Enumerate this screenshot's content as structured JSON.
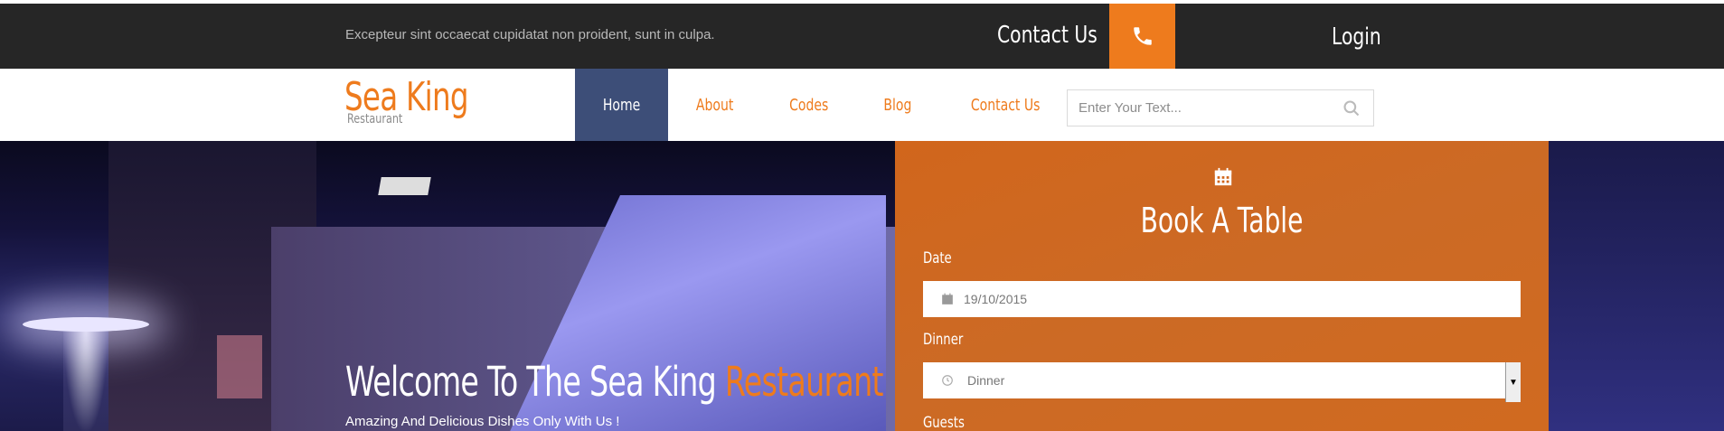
{
  "topbar": {
    "tagline": "Excepteur sint occaecat cupidatat non proident, sunt in culpa.",
    "contact_label": "Contact Us",
    "login_label": "Login",
    "phone_icon": "phone-icon",
    "background": "#262626",
    "accent": "#ee7b1d"
  },
  "logo": {
    "title": "Sea King",
    "subtitle": "Restaurant"
  },
  "nav": {
    "items": [
      {
        "label": "Home",
        "active": true
      },
      {
        "label": "About"
      },
      {
        "label": "Codes"
      },
      {
        "label": "Blog"
      },
      {
        "label": "Contact Us"
      }
    ],
    "active_color": "#3d4e78"
  },
  "search": {
    "placeholder": "Enter Your Text...",
    "icon": "search-icon"
  },
  "hero": {
    "title_main": "Welcome To The Sea King ",
    "title_accent": "Restaurant",
    "subtitle": "Amazing And Delicious Dishes Only With Us !"
  },
  "booking": {
    "title": "Book A Table",
    "icon": "calendar-icon",
    "date_label": "Date",
    "date_value": "19/10/2015",
    "meal_label": "Dinner",
    "meal_value": "Dinner",
    "guests_label": "Guests",
    "background": "#d1661c"
  }
}
